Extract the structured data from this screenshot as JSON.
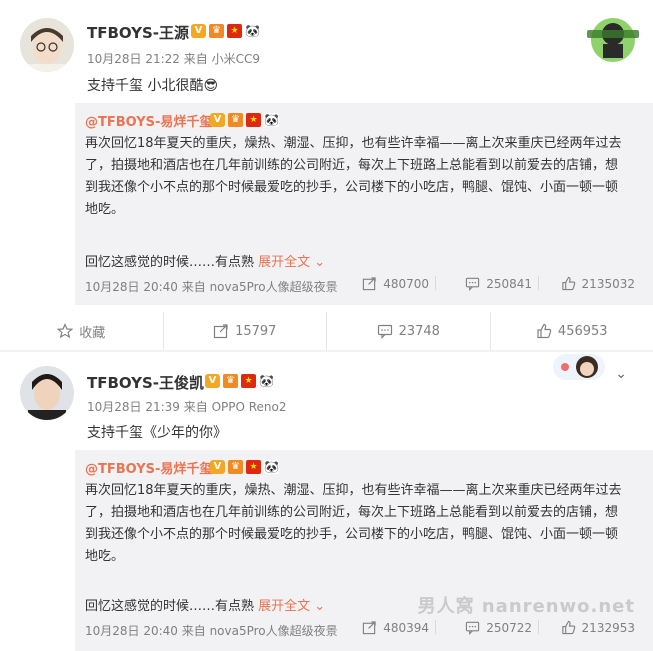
{
  "post1": {
    "username": "TFBOYS-王源",
    "meta": "10月28日 21:22 来自 小米CC9",
    "text": "支持千玺 小北很酷😎"
  },
  "repost1": {
    "author": "@TFBOYS-易烊千玺",
    "lines": [
      "再次回忆18年夏天的重庆，燥热、潮湿、压抑，也有些许幸福——离上次来重庆已经两年过去",
      "了，拍摄地和酒店也在几年前训练的公司附近，每次上下班路上总能看到以前爱去的店铺，想",
      "到我还像个小不点的那个时候最爱吃的抄手，公司楼下的小吃店，鸭腿、馄饨、小面一顿一顿",
      "地吃。"
    ],
    "more_text": "回忆这感觉的时候……有点熟 ",
    "expand_label": "展开全文 ⌄",
    "meta": "10月28日 20:40 来自 nova5Pro人像超级夜景",
    "shares": "480700",
    "comments": "250841",
    "likes": "2135032"
  },
  "actions1": {
    "favorite": "收藏",
    "shares": "15797",
    "comments": "23748",
    "likes": "456953"
  },
  "post2": {
    "username": "TFBOYS-王俊凯",
    "meta": "10月28日 21:39 来自 OPPO Reno2",
    "text": "支持千玺《少年的你》"
  },
  "repost2": {
    "author": "@TFBOYS-易烊千玺",
    "lines": [
      "再次回忆18年夏天的重庆，燥热、潮湿、压抑，也有些许幸福——离上次来重庆已经两年过去",
      "了，拍摄地和酒店也在几年前训练的公司附近，每次上下班路上总能看到以前爱去的店铺，想",
      "到我还像个小不点的那个时候最爱吃的抄手，公司楼下的小吃店，鸭腿、馄饨、小面一顿一顿",
      "地吃。"
    ],
    "more_text": "回忆这感觉的时候……有点熟 ",
    "expand_label": "展开全文 ⌄",
    "meta": "10月28日 20:40 来自 nova5Pro人像超级夜景",
    "shares": "480394",
    "comments": "250722",
    "likes": "2132953"
  },
  "watermark": "男人窝 nanrenwo.net",
  "colors": {
    "accent": "#eb7350",
    "meta": "#808080",
    "repost_bg": "#f2f2f5"
  },
  "icons": [
    "star-icon",
    "share-icon",
    "comment-icon",
    "like-icon",
    "chevron-down-icon"
  ]
}
